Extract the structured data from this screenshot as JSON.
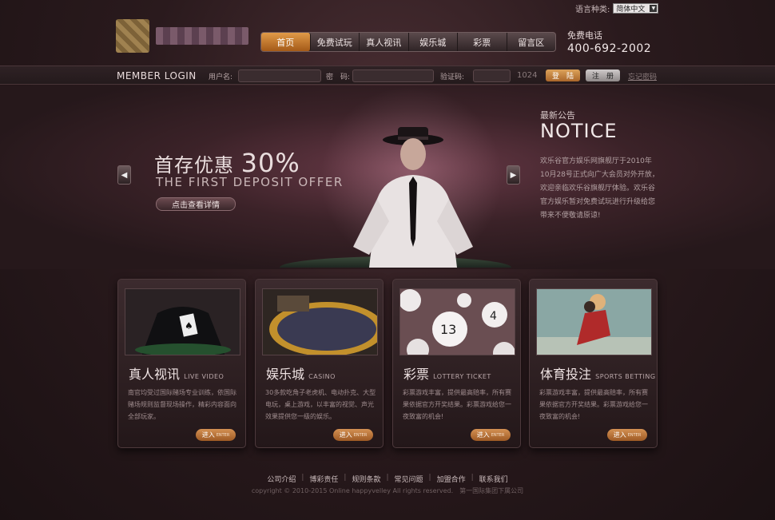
{
  "header": {
    "lang_label": "语言种类:",
    "lang_selected": "简体中文",
    "hotline_label": "免费电话",
    "hotline_number": "400-692-2002"
  },
  "nav": {
    "items": [
      "首页",
      "免费试玩",
      "真人视讯",
      "娱乐城",
      "彩票",
      "留言区"
    ],
    "active_index": 0
  },
  "login": {
    "title": "MEMBER LOGIN",
    "username_label": "用户名:",
    "password_label": "密　码:",
    "captcha_label": "验证码:",
    "captcha_value": "1024",
    "login_button": "登　陆",
    "register_button": "注　册",
    "forgot_link": "忘记密码"
  },
  "banner": {
    "promo_title": "首存优惠",
    "promo_percent": "30%",
    "promo_subtitle": "THE FIRST DEPOSIT OFFER",
    "promo_button": "点击查看详情",
    "prev_icon": "chevron-left-icon",
    "next_icon": "chevron-right-icon"
  },
  "notice": {
    "title_cn": "最新公告",
    "title_en": "NOTICE",
    "body": "欢乐谷官方娱乐网旗舰厅于2010年10月28号正式向广大会员对外开放，欢迎亲临欢乐谷旗舰厅体验。欢乐谷官方娱乐暂对免费试玩进行升级给您带来不便敬请原谅!"
  },
  "cards": [
    {
      "title_cn": "真人视讯",
      "title_en": "LIVE VIDEO",
      "desc": "南官均受过国际赌场专业训练，依国际赌场规则监督现场操作，精彩内容面向全部玩家。",
      "button_cn": "进入",
      "button_en": "ENTER"
    },
    {
      "title_cn": "娱乐城",
      "title_en": "CASINO",
      "desc": "30多款吃角子老虎机、电动扑克、大型电玩，桌上游戏，以丰富的视觉、声光效果提供您一级的娱乐。",
      "button_cn": "进入",
      "button_en": "ENTER"
    },
    {
      "title_cn": "彩票",
      "title_en": "LOTTERY TICKET",
      "desc": "彩票游戏丰富，提供最高赔率，所有赛果依据官方开奖结果。彩票游戏给您一夜致富的机会!",
      "button_cn": "进入",
      "button_en": "ENTER"
    },
    {
      "title_cn": "体育投注",
      "title_en": "SPORTS BETTING",
      "desc": "彩票游戏丰富，提供最高赔率，所有赛果依据官方开奖结果。彩票游戏给您一夜致富的机会!",
      "button_cn": "进入",
      "button_en": "ENTER"
    }
  ],
  "footer": {
    "links": [
      "公司介绍",
      "博彩责任",
      "规则条款",
      "常见问题",
      "加盟合作",
      "联系我们"
    ],
    "copyright": "copyright © 2010-2015 Online happyvelley All rights reserved.　第一国际集团下属公司"
  }
}
